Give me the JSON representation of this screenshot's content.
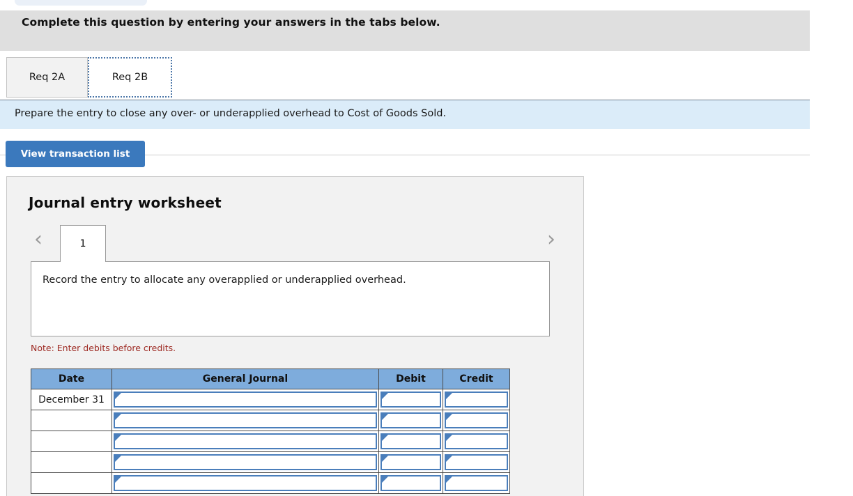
{
  "banner": {
    "text": "Complete this question by entering your answers in the tabs below."
  },
  "tabs": [
    {
      "label": "Req 2A",
      "active": false
    },
    {
      "label": "Req 2B",
      "active": true
    }
  ],
  "instruction": {
    "text": "Prepare the entry to close any over- or underapplied overhead to Cost of Goods Sold."
  },
  "toolbar": {
    "view_transaction_label": "View transaction list"
  },
  "worksheet": {
    "title": "Journal entry worksheet",
    "prev_icon": "‹",
    "next_icon": "›",
    "page_number": "1",
    "description": "Record the entry to allocate any overapplied or underapplied overhead.",
    "note": "Note: Enter debits before credits."
  },
  "journal": {
    "columns": [
      "Date",
      "General Journal",
      "Debit",
      "Credit"
    ],
    "rows": [
      {
        "date": "December 31",
        "general_journal": "",
        "debit": "",
        "credit": ""
      },
      {
        "date": "",
        "general_journal": "",
        "debit": "",
        "credit": ""
      },
      {
        "date": "",
        "general_journal": "",
        "debit": "",
        "credit": ""
      },
      {
        "date": "",
        "general_journal": "",
        "debit": "",
        "credit": ""
      },
      {
        "date": "",
        "general_journal": "",
        "debit": "",
        "credit": ""
      }
    ]
  },
  "colors": {
    "banner_bg": "#dfdfdf",
    "instruction_bg": "#dbecf9",
    "button_blue": "#3b79bd",
    "table_header_blue": "#7eacdc",
    "input_border_blue": "#4a7ebb",
    "note_red": "#9e2b24",
    "panel_bg": "#f2f2f2"
  }
}
